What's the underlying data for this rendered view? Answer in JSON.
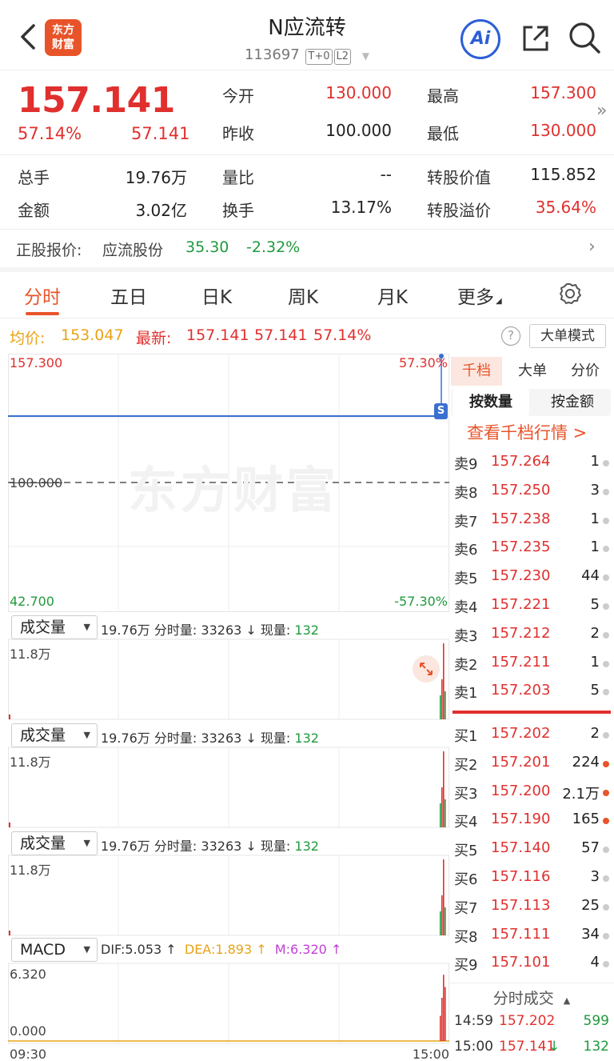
{
  "header": {
    "logo_text": "东方\n财富",
    "title": "N应流转",
    "code": "113697",
    "tag_t0": "T+0",
    "tag_l2": "L2",
    "ai_label": "Ai"
  },
  "quote": {
    "price": "157.141",
    "change_pct": "57.14%",
    "change": "57.141",
    "today_open_label": "今开",
    "today_open": "130.000",
    "high_label": "最高",
    "high": "157.300",
    "prev_close_label": "昨收",
    "prev_close": "100.000",
    "low_label": "最低",
    "low": "130.000",
    "volume_label": "总手",
    "volume": "19.76万",
    "vol_ratio_label": "量比",
    "vol_ratio": "--",
    "conv_value_label": "转股价值",
    "conv_value": "115.852",
    "amount_label": "金额",
    "amount": "3.02亿",
    "turnover_label": "换手",
    "turnover": "13.17%",
    "premium_label": "转股溢价",
    "premium": "35.64%"
  },
  "stock": {
    "label": "正股报价:",
    "name": "应流股份",
    "price": "35.30",
    "change_pct": "-2.32%"
  },
  "tabs": [
    "分时",
    "五日",
    "日K",
    "周K",
    "月K",
    "更多"
  ],
  "avg_bar": {
    "avg_label": "均价:",
    "avg_value": "153.047",
    "latest_label": "最新:",
    "latest_price": "157.141",
    "latest_change": "57.141",
    "latest_pct": "57.14%",
    "help": "?",
    "big_order_mode": "大单模式"
  },
  "chart": {
    "price_top": "157.300",
    "pct_top": "57.30%",
    "price_mid": "100.000",
    "price_bottom": "42.700",
    "pct_bottom": "-57.30%",
    "watermark": "东方财富",
    "s_marker": "S",
    "vol_pane": {
      "select": "成交量",
      "total": "19.76万",
      "bucket_label": "分时量:",
      "bucket_value": "33263",
      "now_label": "现量:",
      "now_value": "132",
      "ymax": "11.8万"
    },
    "macd": {
      "select": "MACD",
      "dif": "DIF:5.053",
      "dea": "DEA:1.893",
      "m": "M:6.320",
      "ymax": "6.320",
      "ymin": "0.000"
    },
    "time_start": "09:30",
    "time_end": "15:00"
  },
  "book": {
    "tabs": [
      "千档",
      "大单",
      "分价"
    ],
    "sub": [
      "按数量",
      "按金额"
    ],
    "link": "查看千档行情 >",
    "asks": [
      {
        "k": "卖9",
        "p": "157.264",
        "v": "1",
        "hot": false
      },
      {
        "k": "卖8",
        "p": "157.250",
        "v": "3",
        "hot": false
      },
      {
        "k": "卖7",
        "p": "157.238",
        "v": "1",
        "hot": false
      },
      {
        "k": "卖6",
        "p": "157.235",
        "v": "1",
        "hot": false
      },
      {
        "k": "卖5",
        "p": "157.230",
        "v": "44",
        "hot": false
      },
      {
        "k": "卖4",
        "p": "157.221",
        "v": "5",
        "hot": false
      },
      {
        "k": "卖3",
        "p": "157.212",
        "v": "2",
        "hot": false
      },
      {
        "k": "卖2",
        "p": "157.211",
        "v": "1",
        "hot": false
      },
      {
        "k": "卖1",
        "p": "157.203",
        "v": "5",
        "hot": false
      }
    ],
    "bids": [
      {
        "k": "买1",
        "p": "157.202",
        "v": "2",
        "hot": false
      },
      {
        "k": "买2",
        "p": "157.201",
        "v": "224",
        "hot": true
      },
      {
        "k": "买3",
        "p": "157.200",
        "v": "2.1万",
        "hot": true
      },
      {
        "k": "买4",
        "p": "157.190",
        "v": "165",
        "hot": true
      },
      {
        "k": "买5",
        "p": "157.140",
        "v": "57",
        "hot": false
      },
      {
        "k": "买6",
        "p": "157.116",
        "v": "3",
        "hot": false
      },
      {
        "k": "买7",
        "p": "157.113",
        "v": "25",
        "hot": false
      },
      {
        "k": "买8",
        "p": "157.111",
        "v": "34",
        "hot": false
      },
      {
        "k": "买9",
        "p": "157.101",
        "v": "4",
        "hot": false
      }
    ],
    "ticks_title": "分时成交",
    "ticks": [
      {
        "t": "14:59",
        "p": "157.202",
        "v": "599",
        "dir": ""
      },
      {
        "t": "15:00",
        "p": "157.141",
        "v": "132",
        "dir": "↓"
      }
    ]
  },
  "colors": {
    "up": "#e0302e",
    "down": "#1f9a3c",
    "brand": "#e8542a",
    "price_line": "#3a6fd0",
    "avg_line": "#e8a317"
  }
}
